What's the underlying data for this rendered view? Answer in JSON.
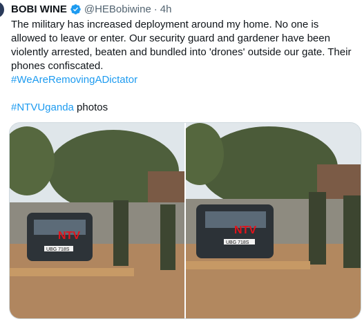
{
  "tweet": {
    "author_name": "BOBI WINE",
    "handle": "@HEBobiwine",
    "separator": "·",
    "time": "4h",
    "text": "The military has increased deployment around my home. No one is allowed to leave or enter. Our security guard and gardener have been violently arrested, beaten and bundled into 'drones' outside our gate. Their phones confiscated.",
    "hashtag1": "#WeAreRemovingADictator",
    "hashtag2": "#NTVUganda",
    "hashtag2_suffix": " photos",
    "photos": [
      {
        "plate": "UBG 718S",
        "watermark": "NTV"
      },
      {
        "plate": "UBG 718S",
        "watermark": "NTV"
      }
    ]
  },
  "colors": {
    "link": "#1d9bf0",
    "verified": "#1d9bf0",
    "muted": "#536471",
    "text": "#0f1419"
  },
  "icons": {
    "verified": "verified-badge-icon"
  }
}
